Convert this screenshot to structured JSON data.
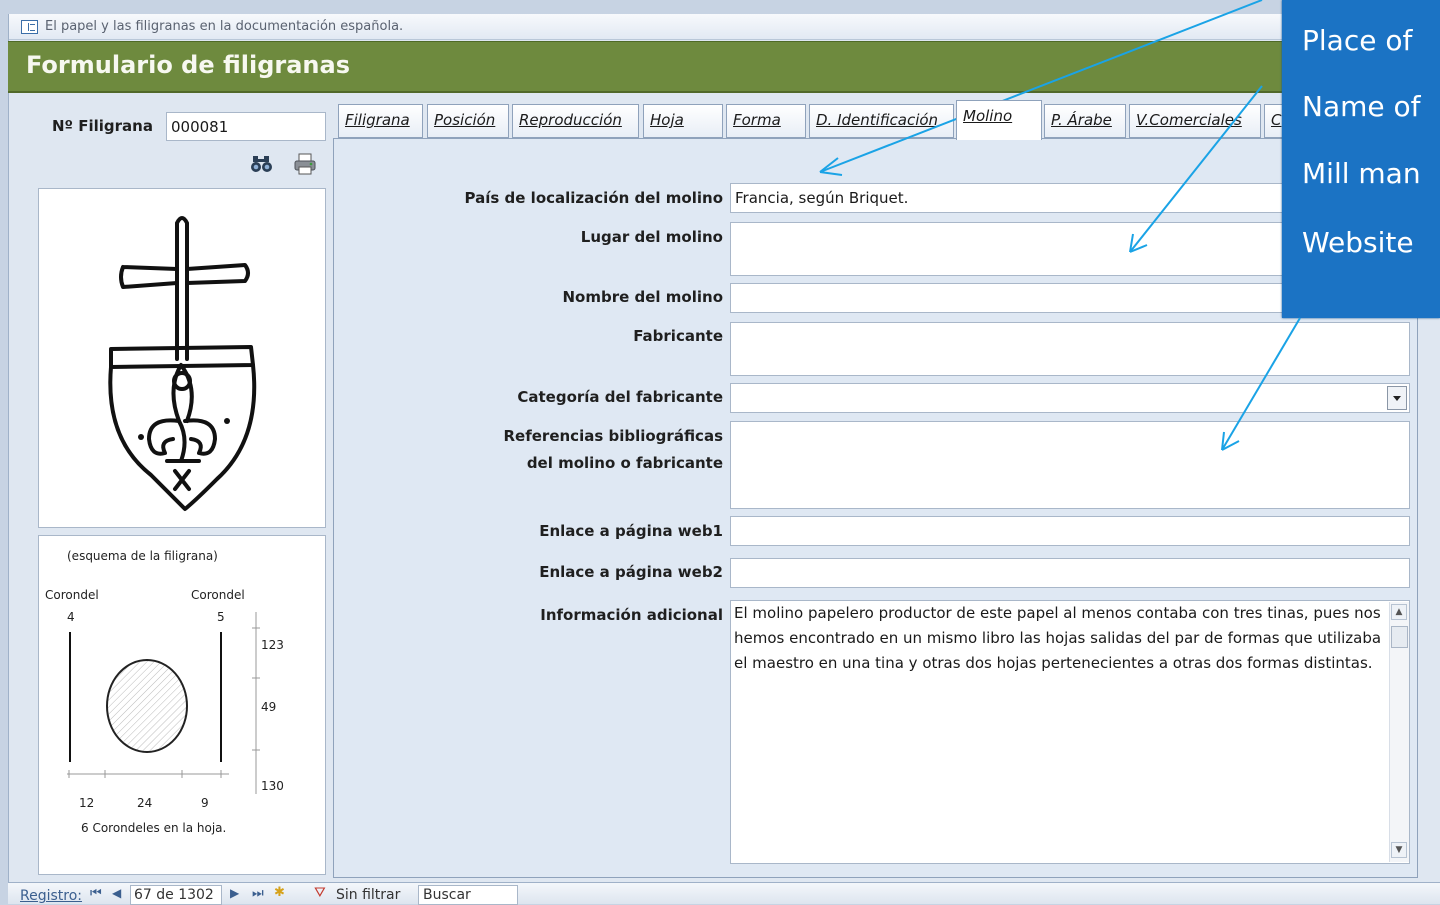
{
  "window": {
    "title": "El papel y las filigranas en la documentación española."
  },
  "header": {
    "form_title": "Formulario de filigranas"
  },
  "left": {
    "filigrana_label": "Nº Filigrana",
    "filigrana_value": "000081",
    "schema": {
      "title": "(esquema de la filigrana)",
      "corondel_left_label": "Corondel",
      "corondel_left_num": "4",
      "corondel_right_label": "Corondel",
      "corondel_right_num": "5",
      "right_measures": [
        "123",
        "49",
        "130"
      ],
      "bottom_measures": [
        "12",
        "24",
        "9"
      ],
      "footer": "6  Corondeles en la hoja."
    }
  },
  "tabs": [
    {
      "label": "Filigrana",
      "active": false
    },
    {
      "label": "Posición",
      "active": false
    },
    {
      "label": "Reproducción",
      "active": false
    },
    {
      "label": "Hoja",
      "active": false
    },
    {
      "label": "Forma",
      "active": false
    },
    {
      "label": "D. Identificación",
      "active": false
    },
    {
      "label": "Molino",
      "active": true
    },
    {
      "label": "P. Árabe",
      "active": false
    },
    {
      "label": "V.Comerciales",
      "active": false
    },
    {
      "label": "C",
      "active": false
    }
  ],
  "molino": {
    "pais_label": "País de localización del molino",
    "pais_value": "Francia, según Briquet.",
    "lugar_label": "Lugar del molino",
    "lugar_value": "",
    "nombre_label": "Nombre del molino",
    "nombre_value": "",
    "fabricante_label": "Fabricante",
    "fabricante_value": "",
    "categoria_label": "Categoría del fabricante",
    "categoria_value": "",
    "referencias_label_1": "Referencias bibliográficas",
    "referencias_label_2": "del molino o fabricante",
    "referencias_value": "",
    "web1_label": "Enlace a página web1",
    "web1_value": "",
    "web2_label": "Enlace a página web2",
    "web2_value": "",
    "info_label": "Información adicional",
    "info_value": "El molino papelero productor de este papel al menos contaba con tres tinas, pues nos hemos encontrado en un mismo libro las hojas salidas del par de formas que utilizaba el maestro en una tina y otras dos hojas pertenecientes a otras dos formas distintas."
  },
  "status": {
    "registro_label": "Registro:",
    "record_text": "67 de 1302",
    "filter_text": "Sin filtrar",
    "search_text": "Buscar"
  },
  "overlay": {
    "lines": [
      "Place of",
      "Name of",
      "Mill man",
      "Website"
    ]
  },
  "colors": {
    "header_green": "#6e8a3e",
    "overlay_blue": "#1b73c4",
    "arrow_blue": "#1aa3e6"
  }
}
